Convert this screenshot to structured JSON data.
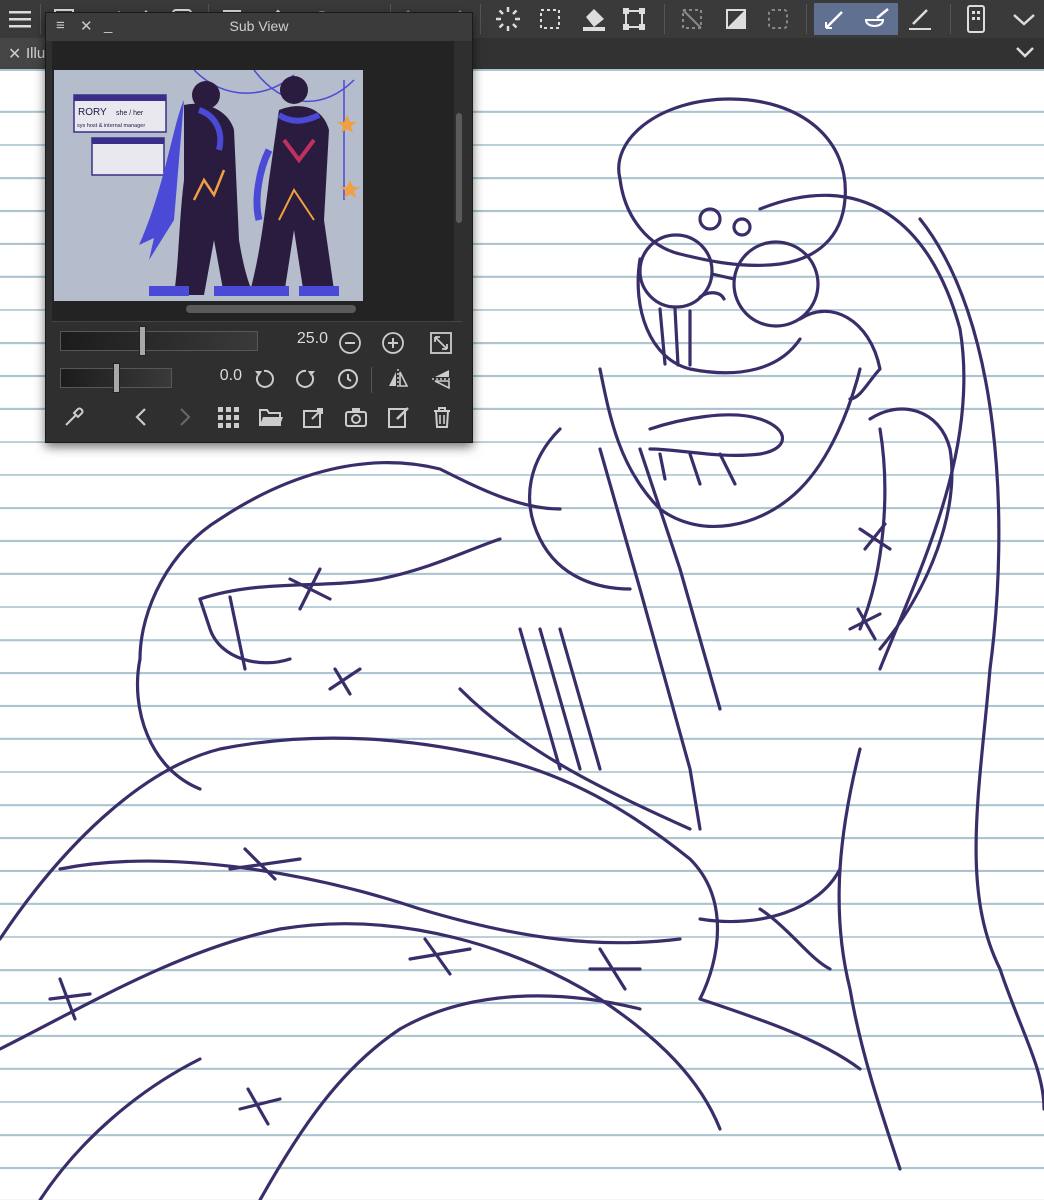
{
  "colors": {
    "toolbar_bg": "#3a3a3a",
    "tab_bg": "#454545",
    "panel_bg": "#2f2f2f",
    "active_tool": "#5f7090",
    "sketch_ink": "#3a2e6a",
    "ruled_line": "#aac4d0",
    "thumb_bg": "#b5bccb",
    "thumb_cape": "#4a4ad6",
    "thumb_body": "#2a1c3e",
    "thumb_accent": "#f0a040"
  },
  "toolbar": {
    "icons": [
      "menu-icon",
      "new-canvas-icon",
      "brush-icon",
      "undo-arrow-icon",
      "image-icon",
      "layer-icon",
      "history-icon",
      "undo-icon",
      "redo-icon",
      "loading-icon",
      "marquee-icon",
      "fill-icon",
      "transform-icon",
      "clear-icon",
      "invert-icon",
      "selection-icon",
      "pen-tool-icon",
      "eraser-tool-icon",
      "line-tool-icon",
      "device-icon",
      "dropdown-icon"
    ]
  },
  "tab": {
    "label": "Illu"
  },
  "subview": {
    "title": "Sub View",
    "zoom_value": "25.0",
    "rotation_value": "0.0",
    "zoom_slider_level": 0.4,
    "rotation_slider_level": 0.5,
    "thumbnail": {
      "name": "RORY",
      "pronouns": "she / her",
      "tagline": "sys host & internal manager"
    }
  }
}
